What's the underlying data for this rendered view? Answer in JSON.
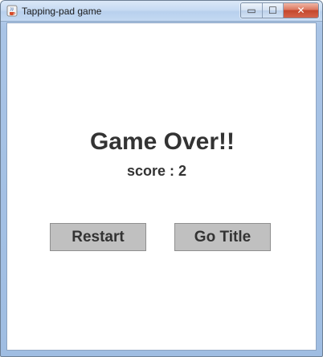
{
  "window": {
    "title": "Tapping-pad game",
    "icon": "java-cup-icon",
    "controls": {
      "minimize_icon": "minimize-icon",
      "maximize_icon": "maximize-icon",
      "close_icon": "close-icon",
      "minimize_glyph": "▭",
      "maximize_glyph": "☐",
      "close_glyph": "✕"
    }
  },
  "game": {
    "status": "Game Over!!",
    "score_label": "score : 2"
  },
  "buttons": {
    "restart_label": "Restart",
    "go_title_label": "Go Title"
  },
  "colors": {
    "text": "#333333",
    "button_bg": "#c0c0c0",
    "window_frame": "#a9c4e6"
  }
}
